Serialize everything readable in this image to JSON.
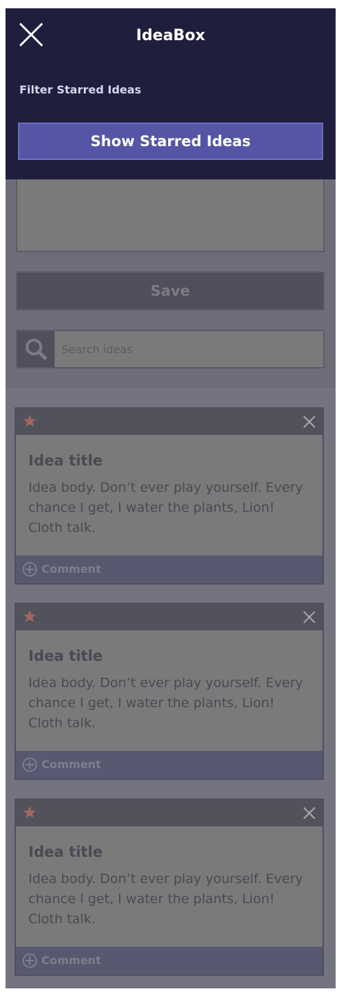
{
  "header": {
    "title": "IdeaBox",
    "close_icon": "close-icon"
  },
  "filter": {
    "label": "Filter Starred Ideas",
    "button_label": "Show Starred Ideas"
  },
  "form": {
    "body_value": "",
    "save_label": "Save",
    "search_placeholder": "Search ideas",
    "search_value": ""
  },
  "ideas": [
    {
      "title": "Idea title",
      "body": "Idea body. Don’t ever play yourself. Every chance I get, I water the plants, Lion! Cloth talk.",
      "comment_label": "Comment"
    },
    {
      "title": "Idea title",
      "body": "Idea body. Don’t ever play yourself. Every chance I get, I water the plants, Lion! Cloth talk.",
      "comment_label": "Comment"
    },
    {
      "title": "Idea title",
      "body": "Idea body. Don’t ever play yourself. Every chance I get, I water the plants, Lion! Cloth talk.",
      "comment_label": "Comment"
    }
  ],
  "colors": {
    "header_bg": "#1f1f3d",
    "accent_button": "#5555a5",
    "star": "#a0675e",
    "overlay_bg": "#6d6d79"
  }
}
